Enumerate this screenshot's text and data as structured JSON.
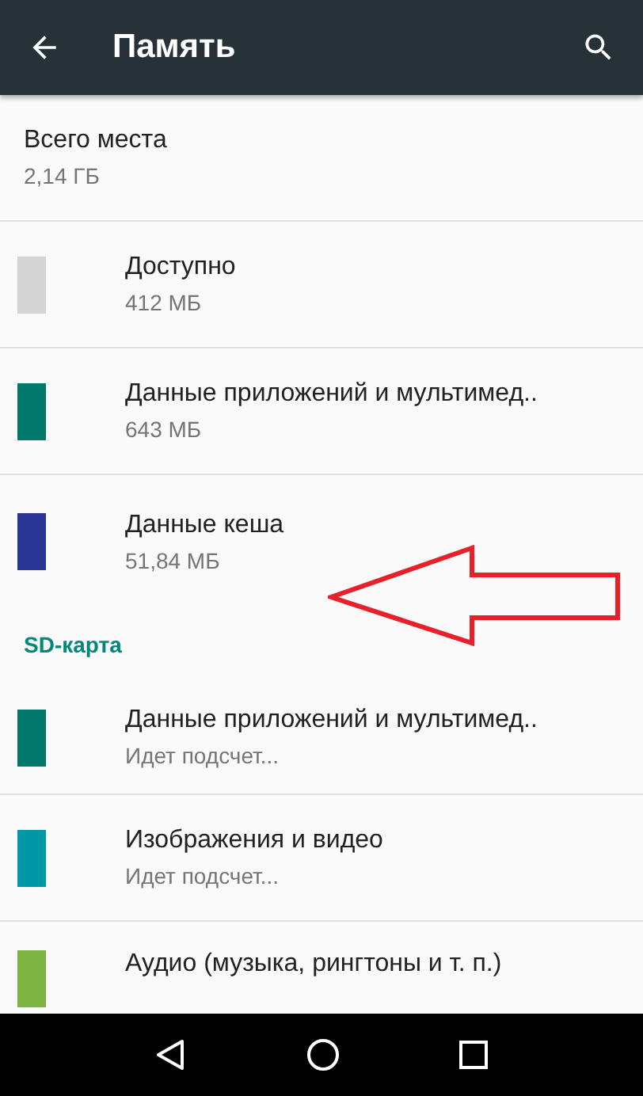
{
  "app_bar": {
    "title": "Память"
  },
  "total": {
    "title": "Всего места",
    "value": "2,14 ГБ"
  },
  "internal_items": [
    {
      "title": "Доступно",
      "value": "412 МБ",
      "color": "#d4d4d4"
    },
    {
      "title": "Данные приложений и мультимед..",
      "value": "643 МБ",
      "color": "#00796b"
    },
    {
      "title": "Данные кеша",
      "value": "51,84 МБ",
      "color": "#283593"
    }
  ],
  "sd_section": {
    "title": "SD-карта",
    "items": [
      {
        "title": "Данные приложений и мультимед..",
        "value": "Идет подсчет...",
        "color": "#00796b"
      },
      {
        "title": "Изображения и видео",
        "value": "Идет подсчет...",
        "color": "#0097a7"
      },
      {
        "title": "Аудио (музыка, рингтоны и т. п.)",
        "color": "#7cb342"
      }
    ]
  },
  "annotation": {
    "kind": "arrow"
  }
}
